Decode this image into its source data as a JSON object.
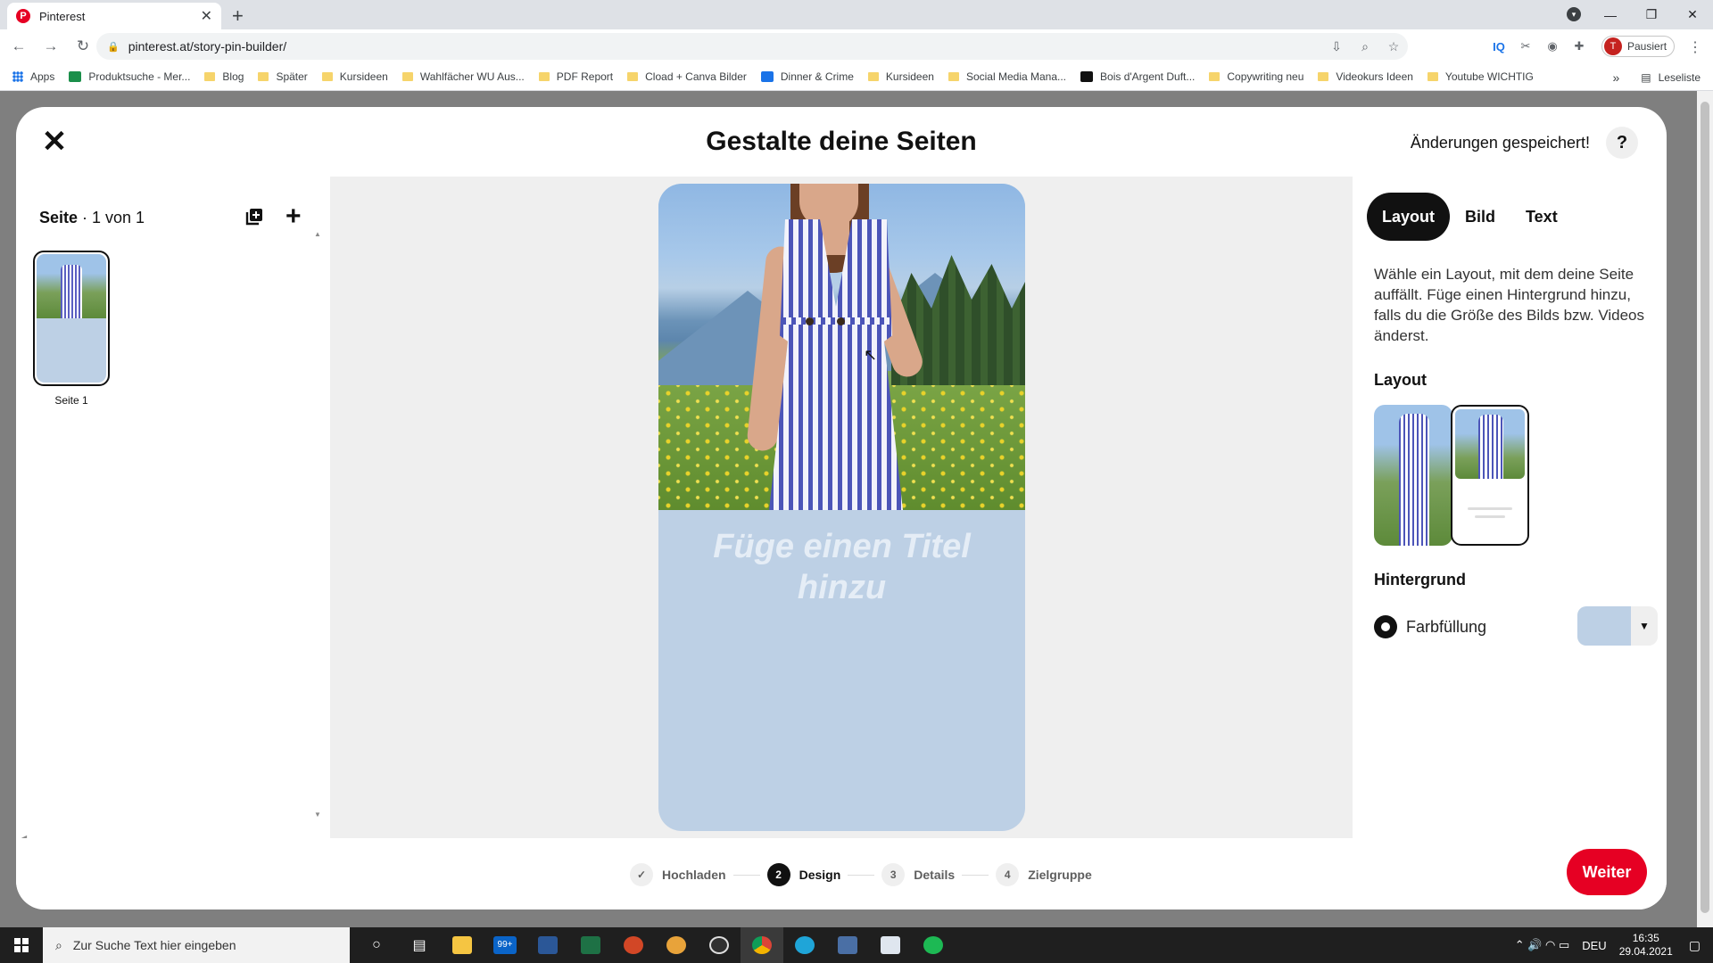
{
  "browser": {
    "tab_title": "Pinterest",
    "tab_favicon": "P",
    "url": "pinterest.at/story-pin-builder/",
    "profile_initial": "T",
    "profile_status": "Pausiert",
    "bookmarks": [
      {
        "label": "Apps",
        "kind": "apps"
      },
      {
        "label": "Produktsuche - Mer...",
        "kind": "site",
        "color": "#1a8f4a"
      },
      {
        "label": "Blog",
        "kind": "folder"
      },
      {
        "label": "Später",
        "kind": "folder"
      },
      {
        "label": "Kursideen",
        "kind": "folder"
      },
      {
        "label": "Wahlfächer WU Aus...",
        "kind": "folder"
      },
      {
        "label": "PDF Report",
        "kind": "folder"
      },
      {
        "label": "Cload + Canva Bilder",
        "kind": "folder"
      },
      {
        "label": "Dinner & Crime",
        "kind": "site",
        "color": "#1a73e8"
      },
      {
        "label": "Kursideen",
        "kind": "folder"
      },
      {
        "label": "Social Media Mana...",
        "kind": "folder"
      },
      {
        "label": "Bois d'Argent Duft...",
        "kind": "site",
        "color": "#111111"
      },
      {
        "label": "Copywriting neu",
        "kind": "folder"
      },
      {
        "label": "Videokurs Ideen",
        "kind": "folder"
      },
      {
        "label": "Youtube WICHTIG",
        "kind": "folder"
      }
    ],
    "reading_list": "Leseliste"
  },
  "modal": {
    "title": "Gestalte deine Seiten",
    "saved_status": "Änderungen gespeichert!",
    "help_label": "?"
  },
  "pages": {
    "label_bold": "Seite",
    "label_count": " · 1 von 1",
    "items": [
      {
        "label": "Seite 1"
      }
    ]
  },
  "canvas": {
    "title_placeholder": "Füge einen Titel hinzu",
    "background_color": "#bdd0e5"
  },
  "panel": {
    "tabs": [
      {
        "label": "Layout",
        "active": true
      },
      {
        "label": "Bild",
        "active": false
      },
      {
        "label": "Text",
        "active": false
      }
    ],
    "description": "Wähle ein Layout, mit dem deine Seite auffällt. Füge einen Hintergrund hinzu, falls du die Größe des Bilds bzw. Videos änderst.",
    "layout_heading": "Layout",
    "background_heading": "Hintergrund",
    "fill_option": "Farbfüllung",
    "fill_color": "#bdd0e5"
  },
  "footer": {
    "steps": [
      {
        "num": "✓",
        "label": "Hochladen",
        "active": false
      },
      {
        "num": "2",
        "label": "Design",
        "active": true
      },
      {
        "num": "3",
        "label": "Details",
        "active": false
      },
      {
        "num": "4",
        "label": "Zielgruppe",
        "active": false
      }
    ],
    "next_button": "Weiter"
  },
  "taskbar": {
    "search_placeholder": "Zur Suche Text hier eingeben",
    "language": "DEU",
    "time": "16:35",
    "date": "29.04.2021",
    "mail_badge": "99+"
  },
  "colors": {
    "accent": "#e60023",
    "dark": "#111111"
  }
}
